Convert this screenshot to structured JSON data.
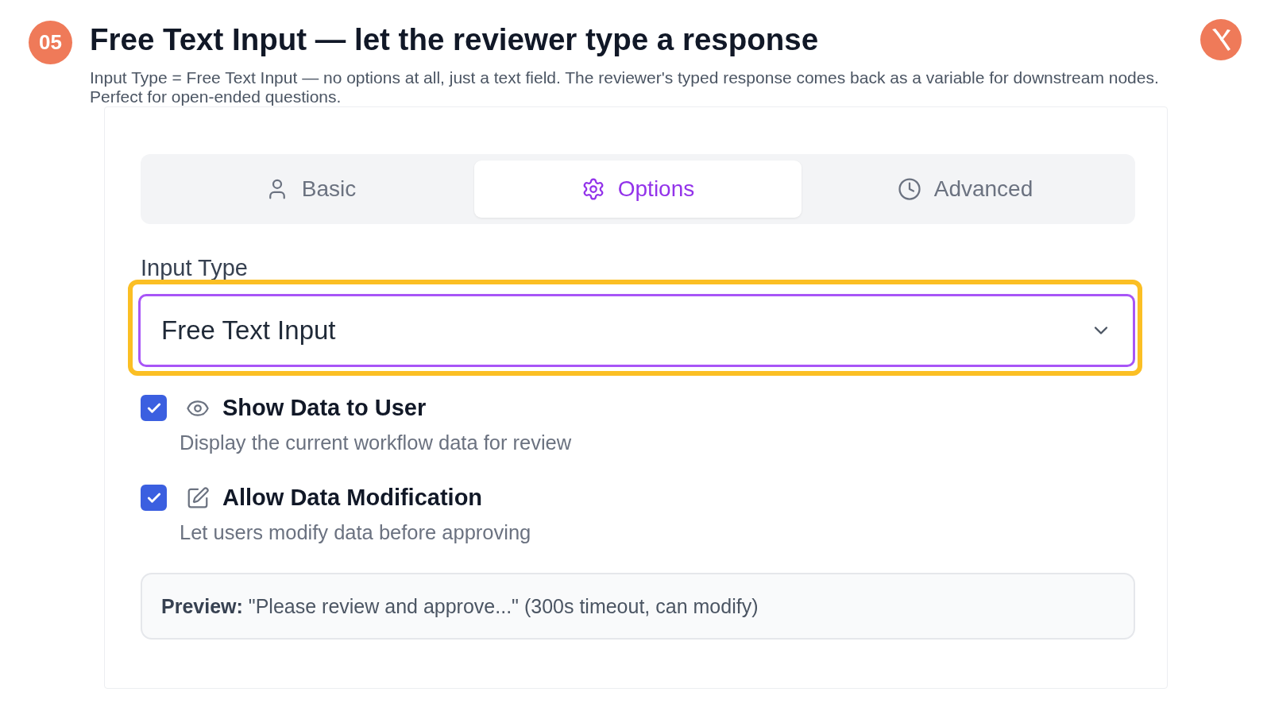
{
  "header": {
    "step_badge": "05",
    "title": "Free Text Input — let the reviewer type a response",
    "description": "Input Type = Free Text Input — no options at all, just a text field. The reviewer's typed response comes back as a variable for downstream nodes. Perfect for open-ended questions."
  },
  "tabs": [
    {
      "label": "Basic",
      "selected": false
    },
    {
      "label": "Options",
      "selected": true
    },
    {
      "label": "Advanced",
      "selected": false
    }
  ],
  "input_type": {
    "label": "Input Type",
    "value": "Free Text Input",
    "highlighted": true
  },
  "options": [
    {
      "label": "Show Data to User",
      "description": "Display the current workflow data for review",
      "checked": true
    },
    {
      "label": "Allow Data Modification",
      "description": "Let users modify data before approving",
      "checked": true
    }
  ],
  "preview": {
    "text": "**Preview:** \"Please review and approve...\" (300s timeout, can modify)"
  }
}
